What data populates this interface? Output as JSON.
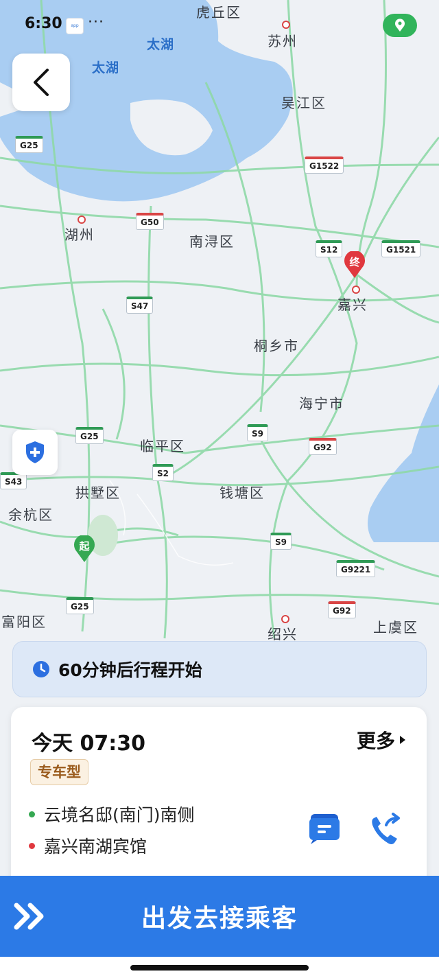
{
  "status_bar": {
    "time": "6:30",
    "more": "···"
  },
  "map": {
    "lakes": [
      {
        "label": "太湖"
      },
      {
        "label": "太湖"
      }
    ],
    "places": [
      "虎丘区",
      "苏州",
      "吴江区",
      "湖州",
      "南浔区",
      "嘉兴",
      "桐乡市",
      "海宁市",
      "临平区",
      "拱墅区",
      "钱塘区",
      "余杭区",
      "富阳区",
      "绍兴",
      "上虞区"
    ],
    "roads": [
      "G25",
      "G1522",
      "G50",
      "S12",
      "G1521",
      "S47",
      "G25",
      "S9",
      "G92",
      "S43",
      "S2",
      "S9",
      "G9221",
      "G25",
      "G92"
    ],
    "start_marker": "起",
    "end_marker": "终"
  },
  "banner": {
    "text": "60分钟后行程开始"
  },
  "order": {
    "time": "今天 07:30",
    "more_label": "更多",
    "car_type": "专车型",
    "pickup": "云境名邸(南门)南侧",
    "dropoff": "嘉兴南湖宾馆"
  },
  "action": {
    "label": "出发去接乘客"
  },
  "colors": {
    "primary": "#2c7ae6",
    "road": "#8fd9a8",
    "water": "#a9cdf2",
    "start": "#35a852",
    "end": "#e0383e"
  }
}
